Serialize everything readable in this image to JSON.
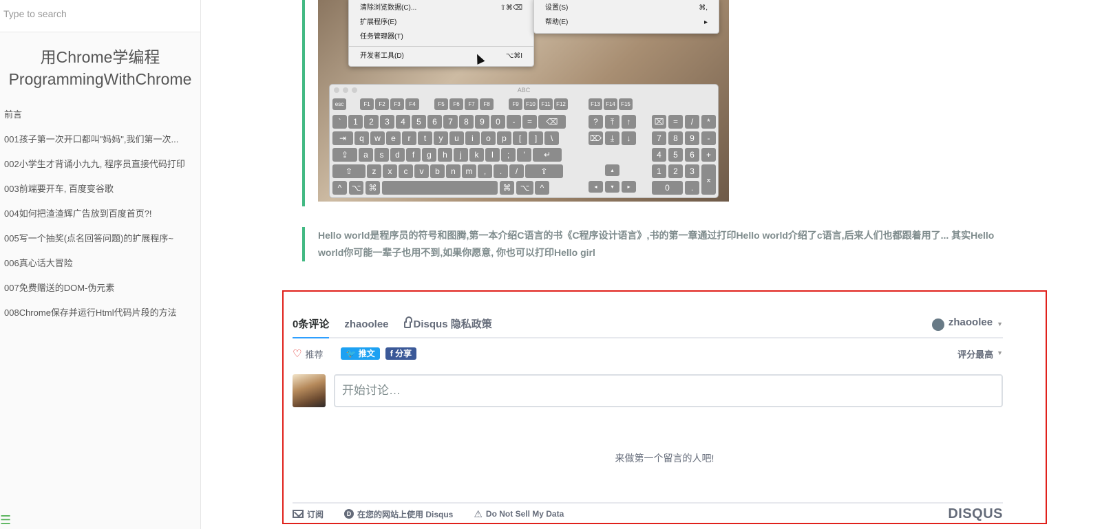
{
  "sidebar": {
    "search_placeholder": "Type to search",
    "title_line1": "用Chrome学编程",
    "title_line2": "ProgrammingWithChrome",
    "items": [
      {
        "label": "前言"
      },
      {
        "label": "001孩子第一次开口都叫\"妈妈\",我们第一次..."
      },
      {
        "label": "002小学生才背诵小九九, 程序员直接代码打印"
      },
      {
        "label": "003前端要开车, 百度变谷歌"
      },
      {
        "label": "004如何把渣渣辉广告放到百度首页?!"
      },
      {
        "label": "005写一个抽奖(点名回答问题)的扩展程序~"
      },
      {
        "label": "006真心话大冒险"
      },
      {
        "label": "007免费赠送的DOM-伪元素"
      },
      {
        "label": "008Chrome保存并运行Html代码片段的方法"
      }
    ],
    "menu_icon": "☰"
  },
  "screenshot": {
    "menu_left": [
      {
        "label": "清除浏览数据(C)...",
        "shortcut": "⇧⌘⌫"
      },
      {
        "label": "扩展程序(E)",
        "shortcut": ""
      },
      {
        "label": "任务管理器(T)",
        "shortcut": ""
      },
      {
        "label": "开发者工具(D)",
        "shortcut": "⌥⌘I"
      }
    ],
    "menu_right": [
      {
        "label": "设置(S)",
        "shortcut": "⌘,"
      },
      {
        "label": "帮助(E)",
        "shortcut": "▸"
      }
    ],
    "keyboard_title": "ABC",
    "fn_row": [
      "esc",
      "F1",
      "F2",
      "F3",
      "F4",
      "F5",
      "F6",
      "F7",
      "F8",
      "F9",
      "F10",
      "F11",
      "F12",
      "F13",
      "F14",
      "F15"
    ],
    "row1": [
      "`",
      "1",
      "2",
      "3",
      "4",
      "5",
      "6",
      "7",
      "8",
      "9",
      "0",
      "-",
      "=",
      "⌫"
    ],
    "row2": [
      "⇥",
      "q",
      "w",
      "e",
      "r",
      "t",
      "y",
      "u",
      "i",
      "o",
      "p",
      "[",
      "]",
      "\\"
    ],
    "row3": [
      "⇪",
      "a",
      "s",
      "d",
      "f",
      "g",
      "h",
      "j",
      "k",
      "l",
      ";",
      "'",
      "↵"
    ],
    "row4": [
      "⇧",
      "z",
      "x",
      "c",
      "v",
      "b",
      "n",
      "m",
      ",",
      ".",
      "/",
      "⇧"
    ],
    "row5": [
      "^",
      "⌥",
      "⌘",
      "",
      "⌘",
      "⌥",
      "^"
    ],
    "nav1": [
      "?",
      "⤒",
      "↑"
    ],
    "nav2": [
      "⌦",
      "⤓",
      "↓"
    ],
    "nav_arrows": [
      "◂",
      "▾",
      "▸",
      "▴"
    ],
    "numpad1": [
      "⌧",
      "=",
      "/",
      "*"
    ],
    "numpad2": [
      "7",
      "8",
      "9",
      "-"
    ],
    "numpad3": [
      "4",
      "5",
      "6",
      "+"
    ],
    "numpad4": [
      "1",
      "2",
      "3"
    ],
    "numpad5": [
      "0",
      "."
    ],
    "numpad_enter": "⌅"
  },
  "note": {
    "text": "Hello world是程序员的符号和图腾,第一本介绍C语言的书《C程序设计语言》,书的第一章通过打印Hello world介绍了c语言,后来人们也都跟着用了... 其实Hello world你可能一辈子也用不到,如果你愿意, 你也可以打印Hello girl"
  },
  "disqus": {
    "tabs": [
      {
        "label": "0条评论"
      },
      {
        "label": "zhaoolee"
      },
      {
        "label": "Disqus 隐私政策"
      }
    ],
    "user": "zhaoolee",
    "recommend_label": "推荐",
    "tweet_label": "推文",
    "share_label": "分享",
    "sort_label": "评分最高",
    "compose_placeholder": "开始讨论…",
    "empty_message": "来做第一个留言的人吧!",
    "footer": {
      "subscribe": "订阅",
      "add_disqus": "在您的网站上使用 Disqus",
      "do_not_sell": "Do Not Sell My Data",
      "logo": "DISQUS"
    },
    "accent_color": "#2e9fff",
    "border_color": "#e0201b"
  }
}
